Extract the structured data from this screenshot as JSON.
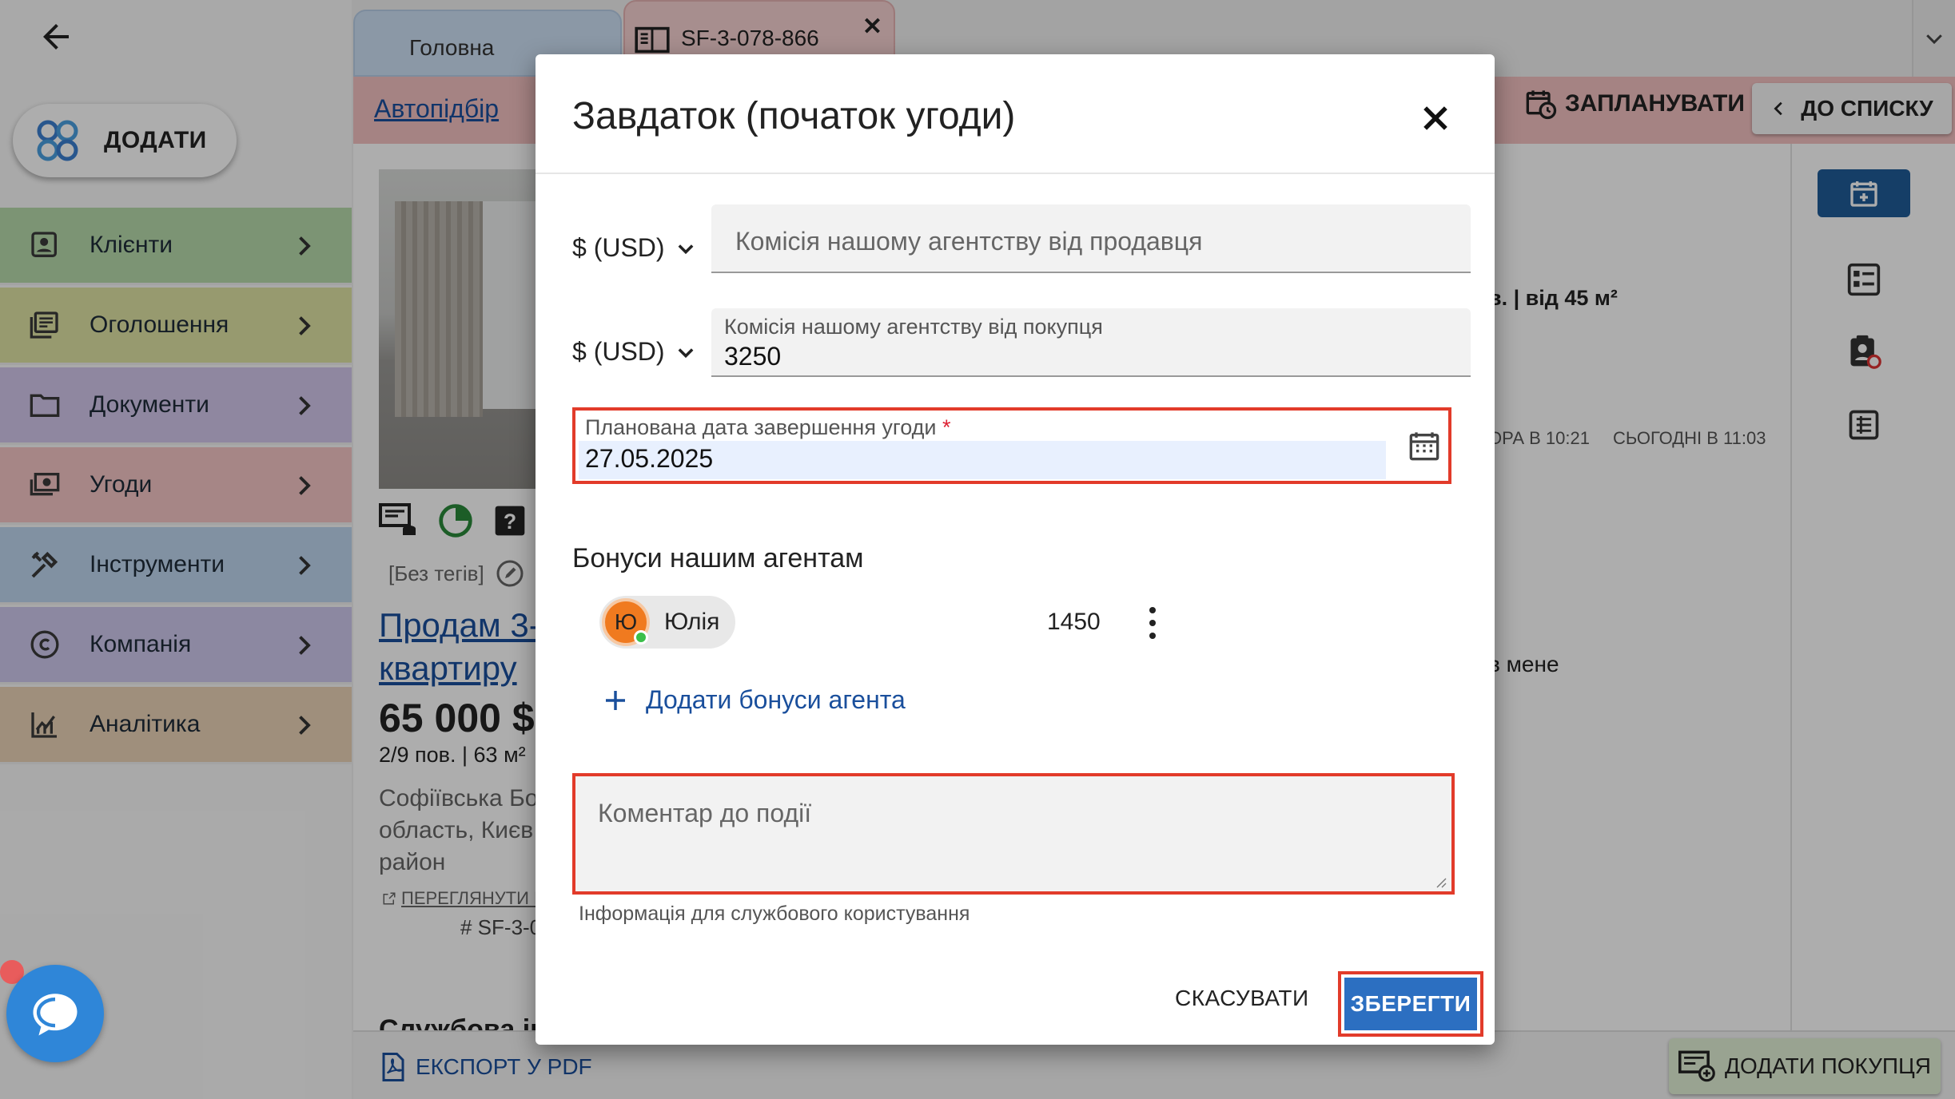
{
  "sidebar": {
    "add_label": "ДОДАТИ",
    "items": [
      {
        "label": "Клієнти",
        "color": "#b7dbac",
        "icon": "contacts-icon"
      },
      {
        "label": "Оголошення",
        "color": "#dfe3a4",
        "icon": "listings-icon"
      },
      {
        "label": "Документи",
        "color": "#d3c7ec",
        "icon": "folder-icon"
      },
      {
        "label": "Угоди",
        "color": "#f5c6c6",
        "icon": "money-icon"
      },
      {
        "label": "Інструменти",
        "color": "#bed6ef",
        "icon": "tools-icon"
      },
      {
        "label": "Компанія",
        "color": "#cfc9ee",
        "icon": "copyright-icon"
      },
      {
        "label": "Аналітика",
        "color": "#ead3b7",
        "icon": "analytics-icon"
      }
    ]
  },
  "tabs": {
    "home": "Головна",
    "active": "SF-3-078-866",
    "close": "✕"
  },
  "header": {
    "link": "Автопідбір",
    "plan_label": "ЗАПЛАНУВАТИ",
    "list_label": "ДО СПИСКУ"
  },
  "listing": {
    "tags": "[Без тегів]",
    "title": "Продам 3-к квартиру",
    "price": "65 000 $",
    "meta": "2/9 пов. | 63 м²",
    "address": "Софіївська Бо\nобласть, Києв\nрайон",
    "view_link": "ПЕРЕГЛЯНУТИ Н",
    "id": "# SF-3-0",
    "service_label": "Службова ін"
  },
  "right_panel": {
    "text1": "в. | від 45 м²",
    "time1": "ОРА В 10:21",
    "time2": "СЬОГОДНІ В 11:03",
    "text4": "в мене"
  },
  "bottom": {
    "export_label": "ЕКСПОРТ У PDF",
    "add_buyer_label": "ДОДАТИ ПОКУПЦЯ"
  },
  "dialog": {
    "title": "Завдаток (початок угоди)",
    "currency1": "$ (USD)",
    "seller_commission_placeholder": "Комісія нашому агентству від продавця",
    "currency2": "$ (USD)",
    "buyer_commission_label": "Комісія нашому агентству від покупця",
    "buyer_commission_value": "3250",
    "date_label": "Планована дата завершення угоди",
    "date_required": "*",
    "date_value": "27.05.2025",
    "bonus_title": "Бонуси нашим агентам",
    "agent": {
      "initial": "Ю",
      "name": "Юлія",
      "bonus": "1450"
    },
    "add_bonus_label": "Додати бонуси агента",
    "comment_placeholder": "Коментар до події",
    "helper_text": "Інформація для службового користування",
    "cancel_label": "СКАСУВАТИ",
    "save_label": "ЗБЕРЕГТИ"
  },
  "colors": {
    "accent": "#2c6fc1",
    "highlight": "#e23b2a",
    "link": "#1a4f9c"
  }
}
